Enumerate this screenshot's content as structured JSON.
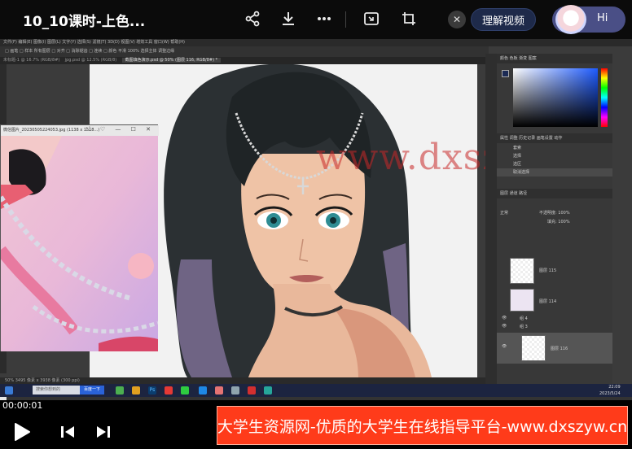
{
  "video": {
    "title": "10_10课时-上色...",
    "understand_label": "理解视频",
    "hi_label": "Hi",
    "timecode": "00:00:01",
    "progress_pct": 1
  },
  "photoshop": {
    "menu": "文件(F)  编辑(E)  图像(I)  图层(L)  文字(Y)  选择(S)  滤镜(T)  3D(D)  视图(V)  增效工具  窗口(W)  帮助(H)",
    "options": "□ 画笔 □ 样本 所有图层 □ 对齐 □ 消除锯齿 □ 连续 □ 颜色 平滑 100%  选择主体  调整边缘",
    "tabs": [
      "未标题-1 @ 16.7% (RGB/8#)",
      "jpg.psd @ 12.5% (RGB/8)"
    ],
    "active_tab": "截图填色演示.psd @ 50% (图层 116, RGB/8#) *",
    "status": "50%   3495 像素 x 3938 像素 (300 ppi)",
    "color_tabs": "颜色   色板   渐变   图案",
    "history_tabs": "属性   调整   历史记录   画笔设置   动作",
    "history_items": [
      "套索",
      "选择",
      "选区",
      "取消选择"
    ],
    "layers_tabs": "图层   通道   路径",
    "layer_blend": "正常",
    "layer_opacity": "不透明度: 100%",
    "layer_fill": "填充: 100%",
    "layers": [
      {
        "name": "图层 115"
      },
      {
        "name": "图层 114"
      },
      {
        "name": "组 4"
      },
      {
        "name": "组 3"
      },
      {
        "name": "图层 116"
      }
    ]
  },
  "reference_window": {
    "title": "微信图片_20230505224053.jpg (1138 x 1518...)"
  },
  "watermark": "www.dxszyw.cn",
  "taskbar": {
    "search_placeholder": "搜索你想到的",
    "search_button": "百度一下",
    "clock_time": "22:09",
    "clock_date": "2023/5/24"
  },
  "banner": {
    "text": "大学生资源网-优质的大学生在线指导平台-www.dxszyw.cn"
  }
}
